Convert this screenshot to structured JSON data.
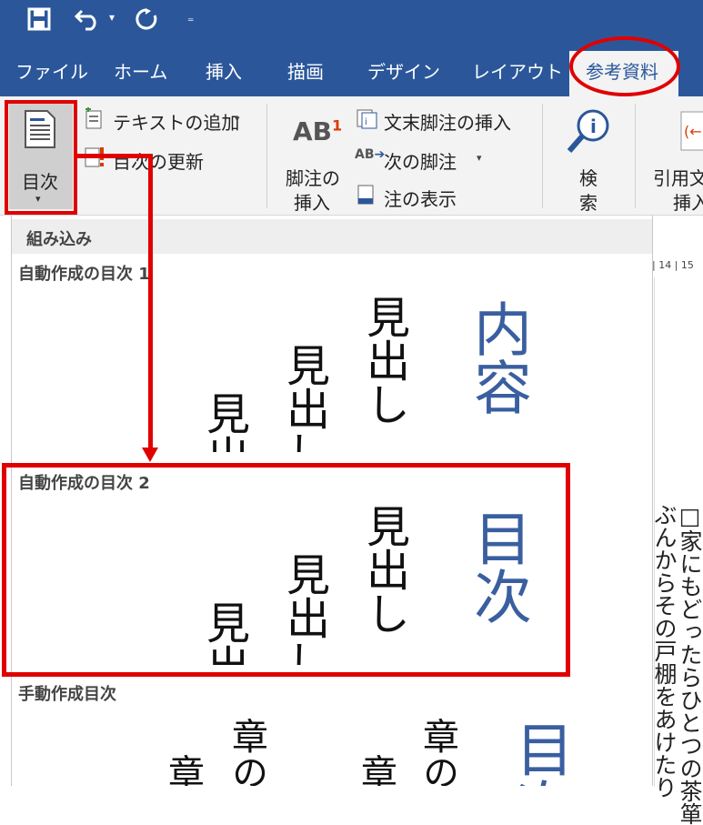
{
  "tabs": {
    "file": "ファイル",
    "home": "ホーム",
    "insert": "挿入",
    "draw": "描画",
    "design": "デザイン",
    "layout": "レイアウト",
    "references": "参考資料"
  },
  "ribbon": {
    "toc_label": "目次",
    "add_text": "テキストの追加",
    "update_table": "目次の更新",
    "footnote_line1": "脚注の",
    "footnote_line2": "挿入",
    "endnote_insert": "文末脚注の挿入",
    "next_footnote": "次の脚注",
    "show_notes": "注の表示",
    "search_line1": "検",
    "search_line2": "索",
    "citation_line1": "引用文",
    "citation_line2": "挿入"
  },
  "gallery": {
    "header": "組み込み",
    "auto1": {
      "title": "自動作成の目次 1",
      "heading": "内容",
      "h1": "見出し",
      "h2": "見出し",
      "h3": "見出"
    },
    "auto2": {
      "title": "自動作成の目次 2",
      "heading": "目次",
      "h1": "見出し",
      "h2": "見出し",
      "h3": "見出"
    },
    "manual": {
      "title": "手動作成目次",
      "heading": "目次",
      "c1": "章の",
      "c2": "章の",
      "c3": "章の",
      "c4": "章の"
    }
  },
  "document": {
    "ruler": "| 14 | 15",
    "line1": "□家にもどったらひとつの茶箪",
    "line2": "ぶんからその戸棚をあけたり"
  },
  "colors": {
    "title_bar": "#2b579a",
    "ribbon_bg": "#f3f3f3",
    "annotation_red": "#e00000",
    "toc_blue": "#3a5fa0"
  }
}
